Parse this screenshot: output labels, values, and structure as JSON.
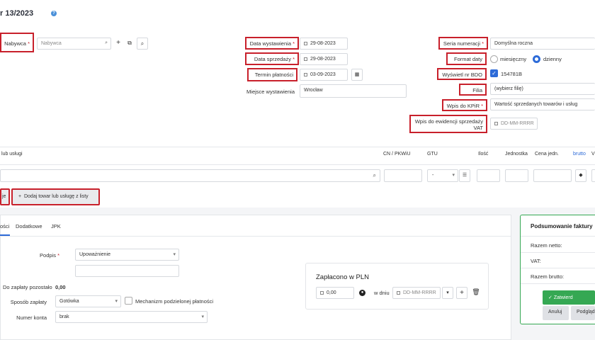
{
  "header": {
    "title": "r 13/2023",
    "info_icon": "info-icon"
  },
  "buyer": {
    "label": "Nabywca",
    "required": "*",
    "placeholder": "Nabywca"
  },
  "dates": {
    "issue_label": "Data wystawienia",
    "issue_value": "29-08-2023",
    "sale_label": "Data sprzedaży",
    "sale_value": "29-08-2023",
    "payment_label": "Termin płatności",
    "payment_value": "03-09-2023",
    "place_label": "Miejsce wystawienia",
    "place_value": "Wrocław",
    "required": "*"
  },
  "settings": {
    "series_label": "Seria numeracji",
    "series_value": "Domyślna roczna",
    "date_format_label": "Format daty",
    "monthly": "miesięczny",
    "daily": "dzienny",
    "bdo_label": "Wyświetl nr BDO",
    "bdo_value": "154781B",
    "branch_label": "Filia",
    "branch_value": "(wybierz filię)",
    "kpir_label": "Wpis do KPiR",
    "kpir_value": "Wartość sprzedanych towarów i usług",
    "vat_label_1": "Wpis do ewidencji sprzedaży",
    "vat_label_2": "VAT",
    "vat_placeholder": "DD-MM-RRRR",
    "required": "*"
  },
  "table": {
    "col_name": "lub usługi",
    "col_cn": "CN / PKWiU",
    "col_gtu": "GTU",
    "col_qty": "Ilość",
    "col_unit": "Jednostka",
    "col_price": "Cena jedn.",
    "col_brutto": "brutto",
    "col_v": "V",
    "gtu_value": "-"
  },
  "actions": {
    "add_left": "je",
    "add_from_list": "Dodaj towar lub usługę z listy"
  },
  "tabs": [
    "ości",
    "Dodatkowe",
    "JPK"
  ],
  "details": {
    "sign_label": "Podpis",
    "sign_value": "Upoważnienie",
    "remaining_label": "Do zapłaty pozostało",
    "remaining_value": "0,00",
    "payment_method_label": "Sposób zapłaty",
    "payment_method_value": "Gotówka",
    "split_payment": "Mechanizm podzielonej płatności",
    "account_label": "Numer konta",
    "account_value": "brak"
  },
  "paid": {
    "title": "Zapłacono w PLN",
    "amount": "0,00",
    "on_day": "w dniu",
    "date_placeholder": "DD-MM-RRRR"
  },
  "summary": {
    "title": "Podsumowanie faktury",
    "netto": "Razem netto:",
    "vat": "VAT:",
    "brutto": "Razem brutto:",
    "approve": "Zatwierd",
    "cancel": "Anuluj",
    "preview": "Podgląd"
  },
  "colors": {
    "accent": "#2d6bd8",
    "highlight": "#c8202b",
    "green": "#35a853"
  }
}
